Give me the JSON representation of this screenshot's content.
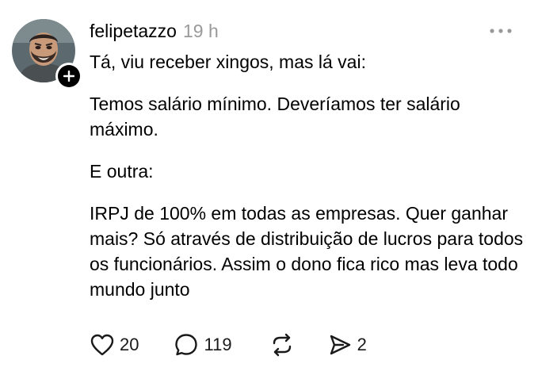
{
  "post": {
    "username": "felipetazzo",
    "timestamp": "19 h",
    "paragraphs": [
      "Tá, viu receber xingos, mas lá vai:",
      "Temos salário mínimo. Deveríamos ter salário máximo.",
      "E outra:",
      "IRPJ de 100% em todas as empresas. Quer ganhar mais? Só através de distribuição de lucros para todos os funcionários. Assim o dono fica rico mas leva todo mundo junto"
    ]
  },
  "actions": {
    "likes": "20",
    "replies": "119",
    "reposts": "",
    "shares": "2"
  },
  "icons": {
    "like": "heart-icon",
    "reply": "speech-bubble-icon",
    "repost": "repost-icon",
    "share": "send-icon",
    "more": "ellipsis-icon",
    "follow": "plus-icon"
  },
  "colors": {
    "text": "#000000",
    "muted": "#9a9a9a",
    "icon": "#1a1a1a"
  }
}
